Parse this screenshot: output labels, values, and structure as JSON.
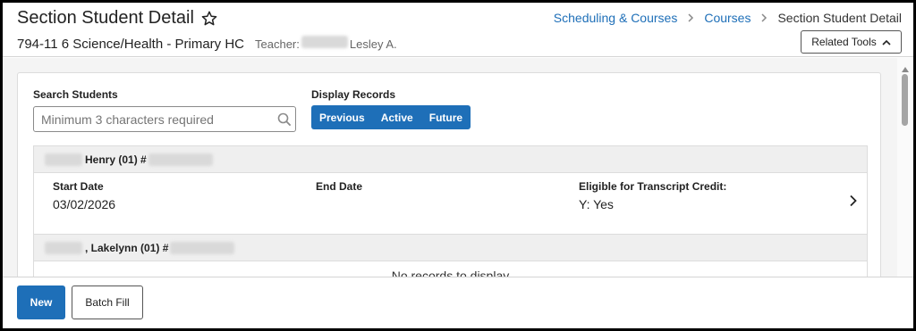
{
  "header": {
    "title": "Section Student Detail",
    "section_name": "794-11 6 Science/Health - Primary HC",
    "teacher_label": "Teacher:",
    "teacher_name": "Lesley A.",
    "related_tools_label": "Related Tools"
  },
  "breadcrumb": {
    "items": [
      "Scheduling & Courses",
      "Courses"
    ],
    "current": "Section Student Detail"
  },
  "search": {
    "label": "Search Students",
    "placeholder": "Minimum 3 characters required",
    "value": ""
  },
  "display_records": {
    "label": "Display Records",
    "options": [
      "Previous",
      "Active",
      "Future"
    ]
  },
  "students": [
    {
      "name": "Henry (01) #",
      "columns": {
        "start_date_label": "Start Date",
        "end_date_label": "End Date",
        "eligible_label": "Eligible for Transcript Credit:"
      },
      "start_date": "03/02/2026",
      "end_date": "",
      "eligible": "Y: Yes"
    },
    {
      "name": ", Lakelynn (01) #",
      "empty_message": "No records to display"
    }
  ],
  "footer": {
    "new_label": "New",
    "batch_fill_label": "Batch Fill"
  },
  "colors": {
    "accent": "#1e6fb8"
  }
}
